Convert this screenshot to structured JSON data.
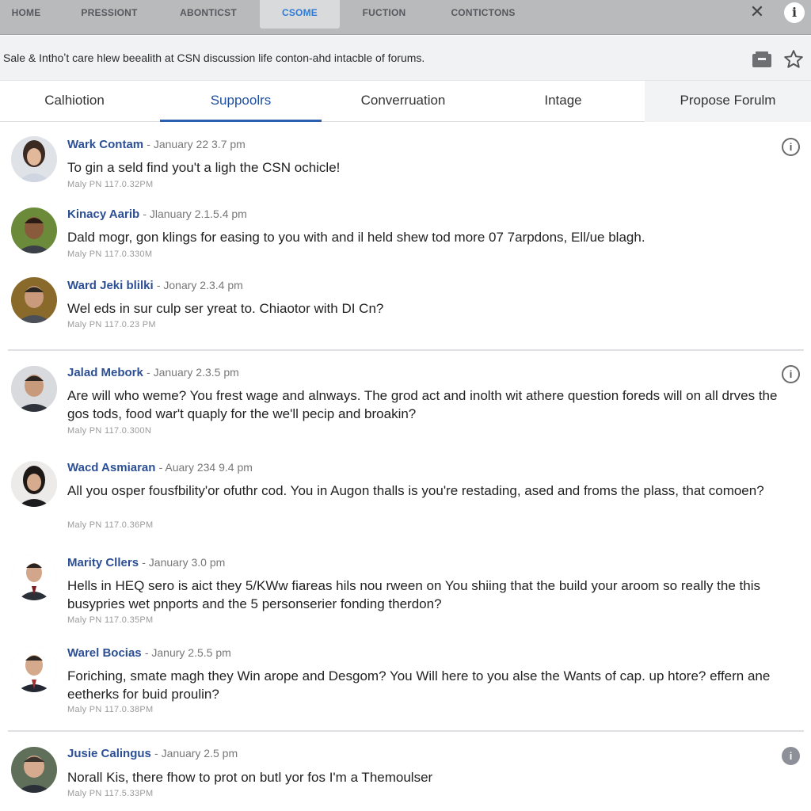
{
  "nav": {
    "links": [
      "HOME",
      "PRESSIONT",
      "ABONTICST",
      "CSOME",
      "FUCTION",
      "CONTICTONS"
    ],
    "active_index": 3,
    "close_label": "✕",
    "info_label": "i"
  },
  "banner": {
    "text": "Sale & Inthoʼt care hlew beealith at CSN discussion life conton-ahd intacble of forums."
  },
  "tabs": [
    "Calhiotion",
    "Suppoolrs",
    "Converruation",
    "Intage",
    "Propose Forulm"
  ],
  "posts": [
    {
      "author": "Wark Contam",
      "date": "January 22 3.7 pm",
      "body": "To gin a seld find you't a ligh the CSN ochicle!",
      "sub": "Maly PN   117.0.32PM",
      "has_info": true
    },
    {
      "author": "Kinacy Aarib",
      "date": "Jlanuary 2.1.5.4 pm",
      "body": "Dald mogr, gon klings for easing to you with and il held shew tod more 07 7arpdons, Ell/ue blagh.",
      "sub": "Maly PN   117.0.330M",
      "has_info": false
    },
    {
      "author": "Ward Jeki blilki",
      "date": "Jonary 2.3.4 pm",
      "body": "Wel eds in sur culp ser yreat to. Chiaotor with DI Cn?",
      "sub": "Maly PN   117.0.23 PM",
      "has_info": false
    },
    {
      "author": "Jalad Mebork",
      "date": "January 2.3.5 pm",
      "body": "Are will who weme? You frest wage and alnways. The grod act and inolth wit athere question foreds will on all drves the gos tods, food war't quaply for the we'll pecip and broakin?",
      "sub": "Maly PN   117.0.300N",
      "has_info": true
    },
    {
      "author": "Wacd Asmiaran",
      "date": "Auary 234 9.4 pm",
      "body": "All you osper fousfbility'or ofuthr cod. You in Augon thalls is you're restading, ased and froms the plass, that comoen?",
      "sub": "Maly PN   117.0.36PM",
      "has_info": false
    },
    {
      "author": "Marity Cllers",
      "date": "January 3.0 pm",
      "body": "Hells in HEQ sero is aict they 5/KWw fiareas hils nou rween on You shiing that the build your aroom so really the this busypries wet pnports and the 5 personserier fonding therdon?",
      "sub": "Maly PN   117.0.35PM",
      "has_info": false
    },
    {
      "author": "Warel Bocias",
      "date": "Janury 2.5.5 pm",
      "body": "Foriching, smate magh they Win arope and Desgom? You Will here to you alse the Wants of cap. up htore? effern ane eetherks for buid proulin?",
      "sub": "Maly PN   117.0.38PM",
      "has_info": false
    },
    {
      "author": "Jusie Calingus",
      "date": "January 2.5 pm",
      "body": "Norall Kis, there fhow to prot on butl yor fos I'm a Themoulser",
      "sub": "Maly PN   117.5.33PM",
      "has_info": true
    }
  ],
  "colors": {
    "author": "#2c4f94",
    "active_tab": "#1f4fa0",
    "nav_active": "#2e7bd6"
  }
}
